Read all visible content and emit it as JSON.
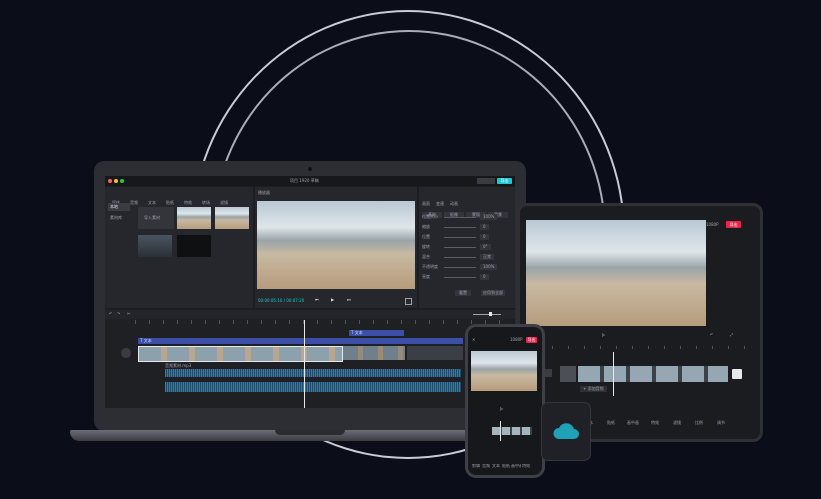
{
  "laptop": {
    "window_title": "项目 1920 草稿",
    "export_label": "导出",
    "media_tabs": [
      "媒体",
      "音频",
      "文本",
      "贴纸",
      "特效",
      "转场",
      "滤镜"
    ],
    "sidebar": [
      "本地",
      "素材库"
    ],
    "import_label": "导入素材",
    "player_title": "播放器",
    "timecode": "00:00:05:10 / 00:07:20",
    "props_tabs": [
      "画面",
      "变速",
      "动画"
    ],
    "props_subtabs": [
      "基础",
      "抠像",
      "蒙版",
      "背景"
    ],
    "props_rows": [
      "位置大小",
      "缩放",
      "位置",
      "旋转",
      "混合",
      "不透明度",
      "亮度"
    ],
    "props_values": [
      "100%",
      "0",
      "0",
      "0°",
      "正常",
      "100%",
      "0"
    ],
    "apply_all_label": "应用到全部",
    "reset_label": "重置",
    "track_text_labels": [
      "T 文本",
      "T 文本"
    ],
    "audio_label": "音频素材.mp3"
  },
  "tablet": {
    "export_label": "导出",
    "ratio_label": "1080P",
    "add_audio_label": "+ 添加音频",
    "tools": [
      "剪辑",
      "音频",
      "文本",
      "贴纸",
      "画中画",
      "特效",
      "滤镜",
      "比例",
      "调节"
    ]
  },
  "phone": {
    "export_label": "导出",
    "ratio_label": "1080P",
    "tools": [
      "剪辑",
      "音频",
      "文本",
      "贴纸",
      "画中画",
      "特效"
    ]
  },
  "cloud": {
    "icon": "cloud-icon"
  },
  "colors": {
    "accent_cyan": "#20c6d4",
    "accent_red": "#e8254a",
    "background": "#0b0d18"
  }
}
